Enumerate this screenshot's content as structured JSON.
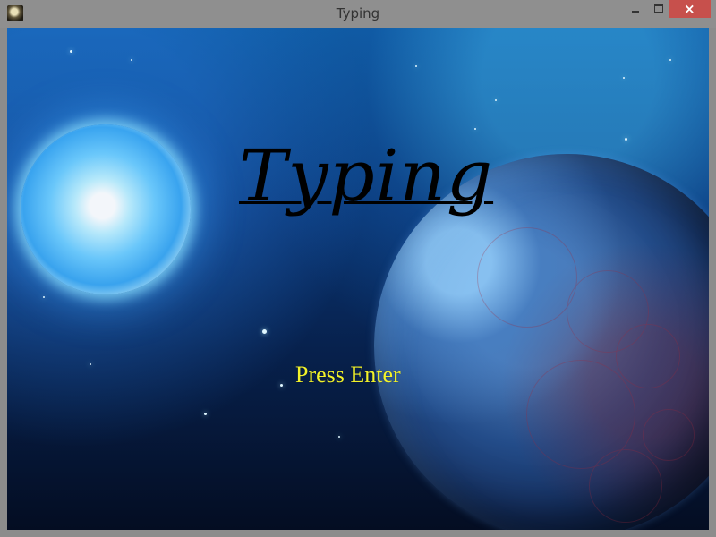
{
  "window": {
    "title": "Typing",
    "controls": {
      "minimize": "minimize",
      "maximize": "maximize",
      "close": "×"
    }
  },
  "game": {
    "title": "Typing",
    "prompt": "Press Enter"
  },
  "colors": {
    "title_text": "#000000",
    "prompt_text": "#f2f22a",
    "close_button": "#c7504c"
  },
  "icons": {
    "app": "app-icon",
    "minimize": "minimize-icon",
    "maximize": "maximize-icon",
    "close": "close-icon"
  }
}
